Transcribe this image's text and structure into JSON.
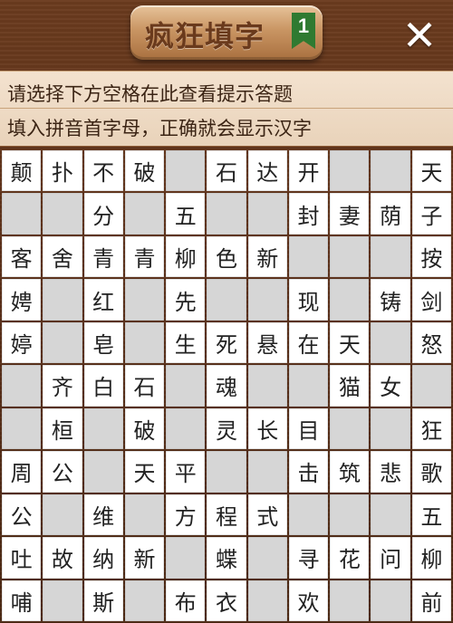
{
  "header": {
    "title": "疯狂填字",
    "level": "1",
    "close_label": "✕"
  },
  "hint": {
    "line1": "请选择下方空格在此查看提示答题",
    "line2": "填入拼音首字母，正确就会显示汉字"
  },
  "grid": {
    "rows": [
      [
        "颠",
        "扑",
        "不",
        "破",
        "",
        "石",
        "达",
        "开",
        "",
        "",
        "天"
      ],
      [
        "",
        "",
        "分",
        "",
        "五",
        "",
        "",
        "封",
        "妻",
        "荫",
        "子"
      ],
      [
        "客",
        "舍",
        "青",
        "青",
        "柳",
        "色",
        "新",
        "",
        "",
        "",
        "按"
      ],
      [
        "娉",
        "",
        "红",
        "",
        "先",
        "",
        "",
        "现",
        "",
        "铸",
        "剑"
      ],
      [
        "婷",
        "",
        "皂",
        "",
        "生",
        "死",
        "悬",
        "在",
        "天",
        "",
        "怒"
      ],
      [
        "",
        "齐",
        "白",
        "石",
        "",
        "魂",
        "",
        "",
        "猫",
        "女",
        ""
      ],
      [
        "",
        "桓",
        "",
        "破",
        "",
        "灵",
        "长",
        "目",
        "",
        "",
        "狂"
      ],
      [
        "周",
        "公",
        "",
        "天",
        "平",
        "",
        "",
        "击",
        "筑",
        "悲",
        "歌"
      ],
      [
        "公",
        "",
        "维",
        "",
        "方",
        "程",
        "式",
        "",
        "",
        "",
        "五"
      ],
      [
        "吐",
        "故",
        "纳",
        "新",
        "",
        "蝶",
        "",
        "寻",
        "花",
        "问",
        "柳"
      ],
      [
        "哺",
        "",
        "斯",
        "",
        "布",
        "衣",
        "",
        "欢",
        "",
        "",
        "前"
      ]
    ]
  }
}
